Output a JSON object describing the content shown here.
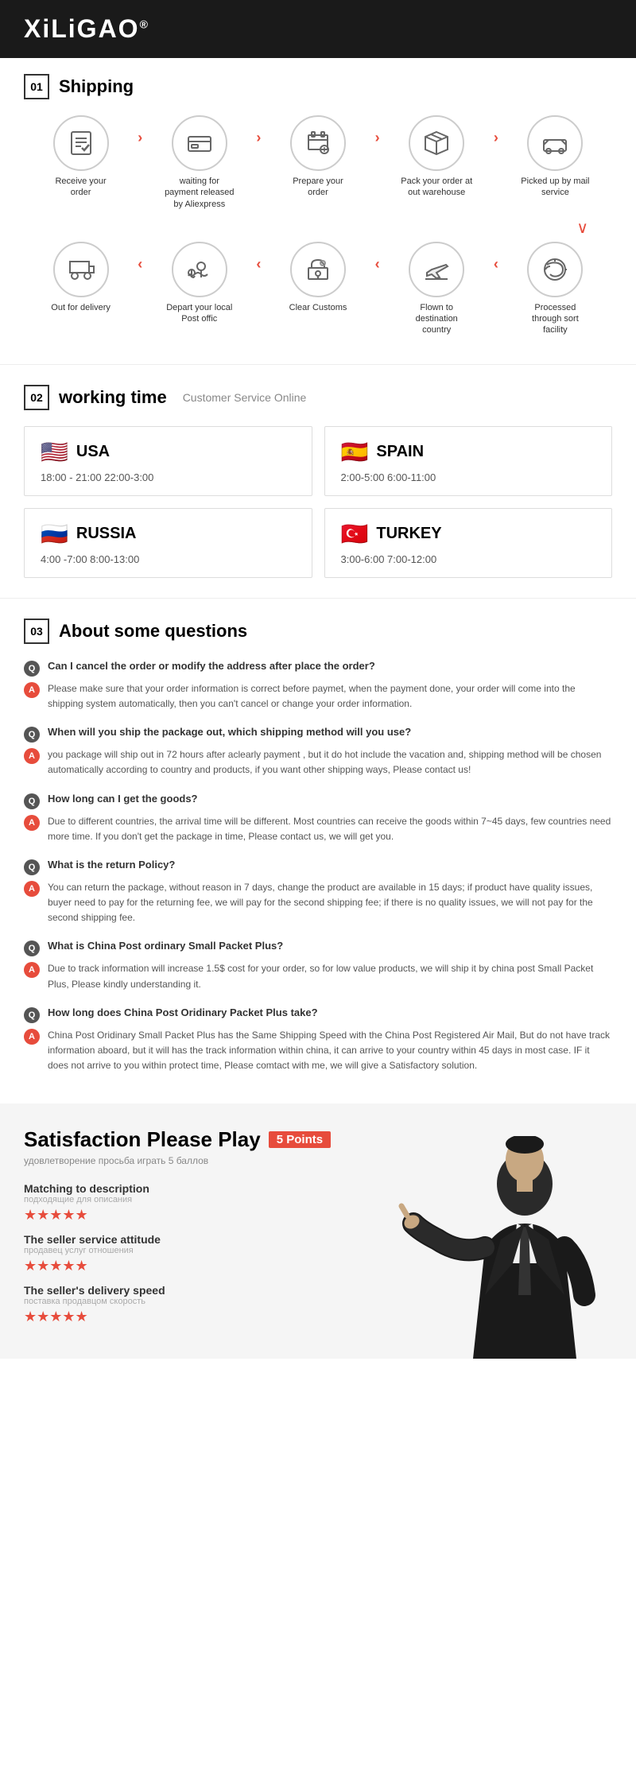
{
  "brand": "XiLiGAO",
  "brand_sup": "®",
  "sections": {
    "shipping": {
      "num": "01",
      "title": "Shipping",
      "row1": [
        {
          "icon": "📋",
          "label": "Receive your order"
        },
        {
          "arrow": ">"
        },
        {
          "icon": "💳",
          "label": "waiting for payment released by Aliexpress"
        },
        {
          "arrow": ">"
        },
        {
          "icon": "🖨️",
          "label": "Prepare your order"
        },
        {
          "arrow": ">"
        },
        {
          "icon": "📦",
          "label": "Pack your order at out warehouse"
        },
        {
          "arrow": ">"
        },
        {
          "icon": "✈️",
          "label": "Picked up by mail service"
        }
      ],
      "arrow_down": "∨",
      "row2": [
        {
          "icon": "📤",
          "label": "Out for delivery"
        },
        {
          "arrow": "<"
        },
        {
          "icon": "🚴",
          "label": "Depart your local Post offic"
        },
        {
          "arrow": "<"
        },
        {
          "icon": "🛂",
          "label": "Clear Customs"
        },
        {
          "arrow": "<"
        },
        {
          "icon": "✈️",
          "label": "Flown to destination country"
        },
        {
          "arrow": "<"
        },
        {
          "icon": "🔄",
          "label": "Processed through sort facility"
        }
      ]
    },
    "working": {
      "num": "02",
      "title": "working time",
      "subtitle": "Customer Service Online",
      "countries": [
        {
          "name": "USA",
          "flag": "🇺🇸",
          "hours": "18:00 - 21:00   22:00-3:00"
        },
        {
          "name": "SPAIN",
          "flag": "🇪🇸",
          "hours": "2:00-5:00   6:00-11:00"
        },
        {
          "name": "RUSSIA",
          "flag": "🇷🇺",
          "hours": "4:00 -7:00   8:00-13:00"
        },
        {
          "name": "TURKEY",
          "flag": "🇹🇷",
          "hours": "3:00-6:00   7:00-12:00"
        }
      ]
    },
    "questions": {
      "num": "03",
      "title": "About some questions",
      "items": [
        {
          "q": "Can I cancel the order or modify the address after place the order?",
          "a": "Please make sure that your order information is correct before paymet, when the payment done, your order will come into the shipping system automatically, then you can't cancel or change your order information."
        },
        {
          "q": "When will you ship the package out, which shipping method will you use?",
          "a": "you package will ship out in 72 hours after aclearly payment , but it do hot include the vacation and, shipping method will be chosen automatically according to country and products, if you want other shipping ways, Please contact us!"
        },
        {
          "q": "How long can I get the goods?",
          "a": "Due to different countries, the arrival time will be different. Most countries can receive the goods within 7~45 days, few countries need more time. If you don't get the package in time, Please contact us, we will get you."
        },
        {
          "q": "What is the return Policy?",
          "a": "You can return the package, without reason in 7 days, change the product are available in 15 days; if product have quality issues, buyer need to pay for the returning fee, we will pay for the second shipping fee; if there is no quality issues, we will not pay for the second shipping fee."
        },
        {
          "q": "What is China Post ordinary Small Packet Plus?",
          "a": "Due to track information will increase 1.5$ cost for your order, so for low value products, we will ship it by china post Small Packet Plus, Please kindly understanding it."
        },
        {
          "q": "How long does China Post Oridinary Packet Plus take?",
          "a": "China Post Oridinary Small Packet Plus has the Same Shipping Speed with the China Post Registered Air Mail, But do not have track information aboard, but it will has the track information within china, it can arrive to your country within 45 days in most case. IF it does not arrive to you within protect time, Please comtact with me, we will give a Satisfactory solution."
        }
      ]
    },
    "satisfaction": {
      "title": "Satisfaction Please Play",
      "badge": "5 Points",
      "sub": "удовлетворение просьба играть 5 баллов",
      "ratings": [
        {
          "label": "Matching to description",
          "sub": "подходящие для описания",
          "stars": "★★★★★"
        },
        {
          "label": "The seller service attitude",
          "sub": "продавец услуг отношения",
          "stars": "★★★★★"
        },
        {
          "label": "The seller's delivery speed",
          "sub": "поставка продавцом скорость",
          "stars": "★★★★★"
        }
      ]
    }
  }
}
